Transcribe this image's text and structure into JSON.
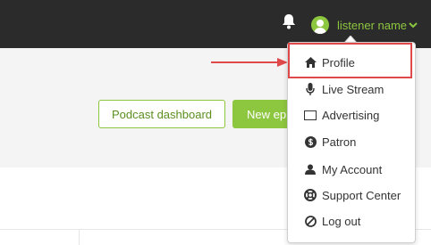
{
  "header": {
    "username": "listener name",
    "bell_icon": "bell-icon",
    "avatar_icon": "user-avatar-icon",
    "chevron_icon": "chevron-down-icon"
  },
  "actions": {
    "podcast_dashboard": "Podcast dashboard",
    "new_episode": "New epi"
  },
  "dropdown": {
    "items": [
      {
        "label": "Profile",
        "icon": "home-icon"
      },
      {
        "label": "Live Stream",
        "icon": "microphone-icon"
      },
      {
        "label": "Advertising",
        "icon": "ad-icon"
      },
      {
        "label": "Patron",
        "icon": "dollar-icon"
      },
      {
        "label": "My Account",
        "icon": "user-icon"
      },
      {
        "label": "Support Center",
        "icon": "lifebuoy-icon"
      },
      {
        "label": "Log out",
        "icon": "ban-icon"
      }
    ]
  },
  "colors": {
    "accent": "#8dc63f",
    "header_bg": "#2b2b2b",
    "annotation": "#e0494a"
  }
}
